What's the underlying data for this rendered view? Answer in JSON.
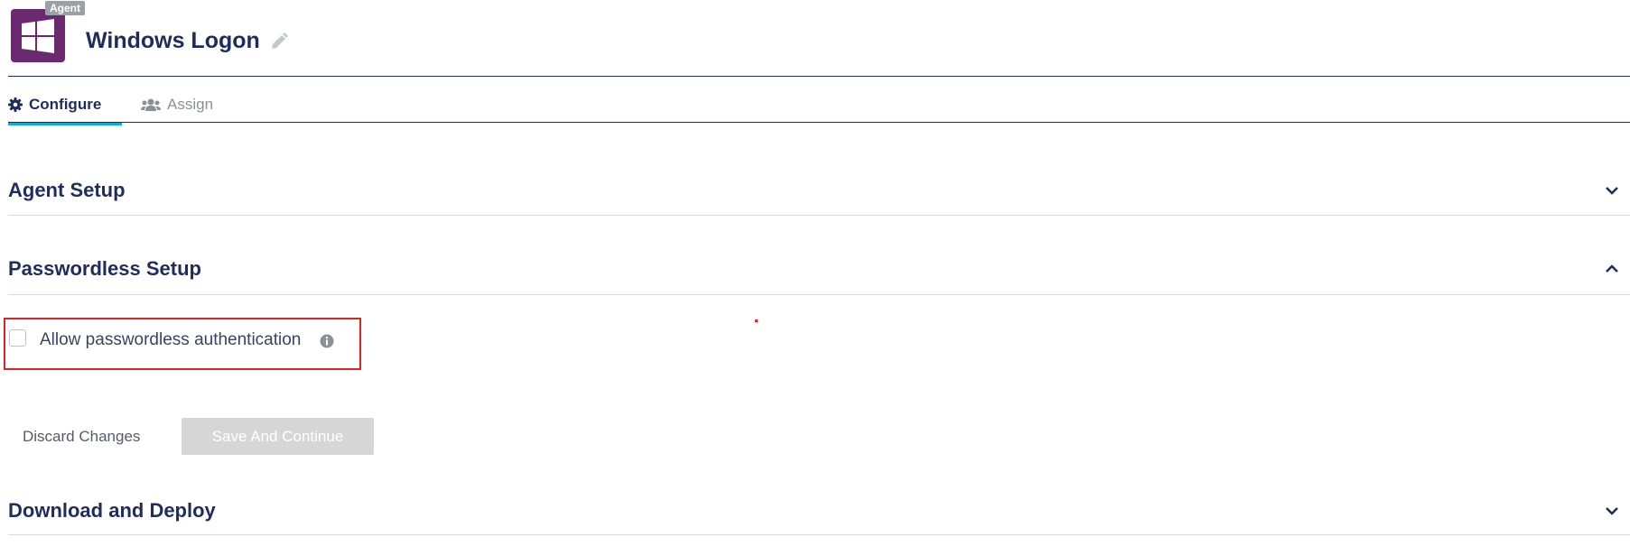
{
  "header": {
    "badge": "Agent",
    "title": "Windows Logon",
    "app_icon": "windows-icon",
    "edit_icon": "pencil-icon"
  },
  "tabs": [
    {
      "label": "Configure",
      "icon": "gear-icon",
      "active": true
    },
    {
      "label": "Assign",
      "icon": "users-icon",
      "active": false
    }
  ],
  "sections": {
    "agent_setup": {
      "title": "Agent Setup",
      "expanded": false
    },
    "passwordless_setup": {
      "title": "Passwordless Setup",
      "expanded": true,
      "checkbox_label": "Allow passwordless authentication",
      "checked": false
    },
    "download_deploy": {
      "title": "Download and Deploy",
      "expanded": false
    }
  },
  "actions": {
    "discard_label": "Discard Changes",
    "save_label": "Save And Continue"
  },
  "colors": {
    "brand_purple": "#6b2a6f",
    "navy_text": "#1f2d5c",
    "active_tab_accent": "#17a9d1",
    "highlight_red": "#e02424",
    "disabled_button": "#d6d6d6"
  }
}
